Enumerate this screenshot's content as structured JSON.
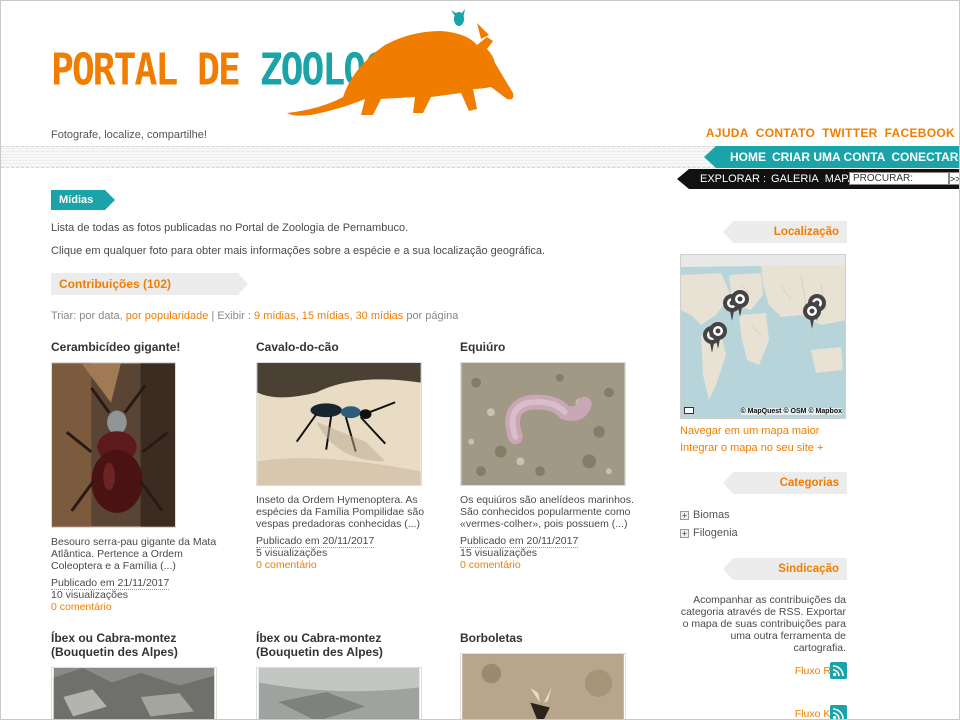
{
  "brand": {
    "title_part1": "PORTAL DE ",
    "title_part2": "ZOOLOGIA",
    "slogan": "Fotografe, localize, compartilhe!",
    "orange": "#f07d00",
    "teal": "#1aa3a8"
  },
  "top_links": [
    "AJUDA",
    "CONTATO",
    "TWITTER",
    "FACEBOOK"
  ],
  "main_nav": [
    "HOME",
    "CRIAR UMA CONTA",
    "CONECTAR-SE"
  ],
  "explore": {
    "label": "EXPLORAR :",
    "links": [
      "GALERIA",
      "MAPA"
    ],
    "search_placeholder": "PROCURAR:",
    "search_go": ">>"
  },
  "section": {
    "title": "Mídias",
    "intro1": "Lista de todas as fotos publicadas no Portal de Zoologia de Pernambuco.",
    "intro2": "Clique em qualquer foto para obter mais informações sobre a espécie e a sua localização geográfica.",
    "contrib_label": "Contribuições (102)"
  },
  "sortbar": {
    "sort_prefix": "Triar: por data, ",
    "sort_popular": "por popularidade",
    "sep": " | Exibir : ",
    "opt9": "9 mídias",
    "comma1": ", ",
    "opt15": "15 mídias",
    "comma2": ", ",
    "opt30": "30 mídias",
    "suffix": " por página"
  },
  "cards": [
    {
      "title": "Cerambicídeo gigante!",
      "desc": "Besouro serra-pau gigante da Mata Atlântica. Pertence a Ordem Coleoptera e a Família (...)",
      "published": "Publicado em 21/11/2017",
      "views": "10 visualizações",
      "comments": "0 comentário"
    },
    {
      "title": "Cavalo-do-cão",
      "desc": "Inseto da Ordem Hymenoptera. As espécies da Família Pompilidae são vespas predadoras conhecidas (...)",
      "published": "Publicado em 20/11/2017",
      "views": "5 visualizações",
      "comments": "0 comentário"
    },
    {
      "title": "Equiúro",
      "desc": "Os equiúros são anelídeos marinhos. São conhecidos popularmente como «vermes-colher», pois possuem (...)",
      "published": "Publicado em 20/11/2017",
      "views": "15 visualizações",
      "comments": "0 comentário"
    },
    {
      "title": "Íbex ou Cabra-montez (Bouquetin des Alpes)"
    },
    {
      "title": "Íbex ou Cabra-montez (Bouquetin des Alpes)"
    },
    {
      "title": "Borboletas"
    }
  ],
  "sidebar": {
    "location_title": "Localização",
    "map_attribution": "© MapQuest © OSM © Mapbox",
    "map_link_big": "Navegar em um mapa maior",
    "map_link_embed": "Integrar o mapa no seu site +",
    "categories_title": "Categorias",
    "categories": [
      "Biomas",
      "Filogenia"
    ],
    "syndication_title": "Sindicação",
    "syndication_text": "Acompanhar as contribuições da categoria através de RSS. Exportar o mapa de suas contribuições para uma outra ferramenta de cartografia.",
    "feed_rss": "Fluxo RSS",
    "feed_kml": "Fluxo KML"
  }
}
